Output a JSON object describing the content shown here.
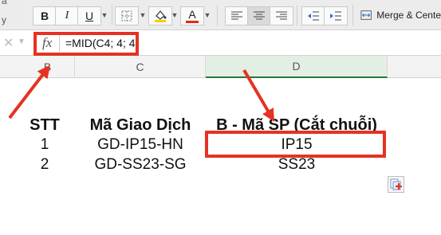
{
  "toolbar": {
    "bold_label": "B",
    "italic_label": "I",
    "underline_label": "U",
    "font_color_label": "A",
    "merge_label": "Merge & Cente",
    "colors": {
      "highlight": "#f5d000",
      "font": "#e0281c"
    }
  },
  "left_edge_fragments": [
    "a",
    "y"
  ],
  "formula_bar": {
    "fx_label": "fx",
    "formula": "=MID(C4; 4; 4)"
  },
  "columns": [
    "B",
    "C",
    "D"
  ],
  "table": {
    "headers": [
      "STT",
      "Mã Giao Dịch",
      "B - Mã SP (Cắt chuỗi)"
    ],
    "rows": [
      [
        "1",
        "GD-IP15-HN",
        "IP15"
      ],
      [
        "2",
        "GD-SS23-SG",
        "SS23"
      ]
    ]
  },
  "accent": "#e53222",
  "icons": [
    "bold-icon",
    "italic-icon",
    "underline-icon",
    "borders-icon",
    "fill-color-icon",
    "font-color-icon",
    "align-left-icon",
    "align-center-icon",
    "align-right-icon",
    "indent-decrease-icon",
    "indent-increase-icon",
    "merge-icon",
    "cancel-icon",
    "paste-options-icon"
  ]
}
